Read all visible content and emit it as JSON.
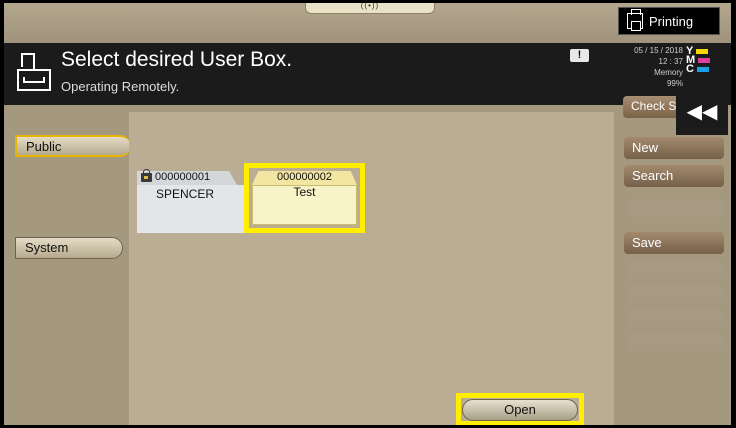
{
  "top_handle": "((•))",
  "printing_label": "Printing",
  "header": {
    "title": "Select desired User Box.",
    "subtitle": "Operating Remotely.",
    "warning": "!"
  },
  "status": {
    "date": "05 / 15 / 2018",
    "time": "12 : 37",
    "memory_label": "Memory",
    "memory_value": "99%",
    "toner": [
      {
        "letter": "Y",
        "color": "#f4d800"
      },
      {
        "letter": "M",
        "color": "#e03c9c"
      },
      {
        "letter": "C",
        "color": "#1ea0e6"
      }
    ]
  },
  "check_status_label": "Check S",
  "collapse_glyph": "◀◀",
  "tabs": {
    "public": "Public",
    "system": "System"
  },
  "boxes": [
    {
      "number": "000000001",
      "name": "SPENCER",
      "locked": true
    },
    {
      "number": "000000002",
      "name": "Test",
      "locked": false
    }
  ],
  "open_label": "Open",
  "right_panel": {
    "new_label": "New",
    "search_label": "Search",
    "save_label": "Save"
  },
  "colors": {
    "highlight": "#ffee00",
    "header_bg": "#1b1b1b",
    "panel_bg": "#a4987f"
  }
}
